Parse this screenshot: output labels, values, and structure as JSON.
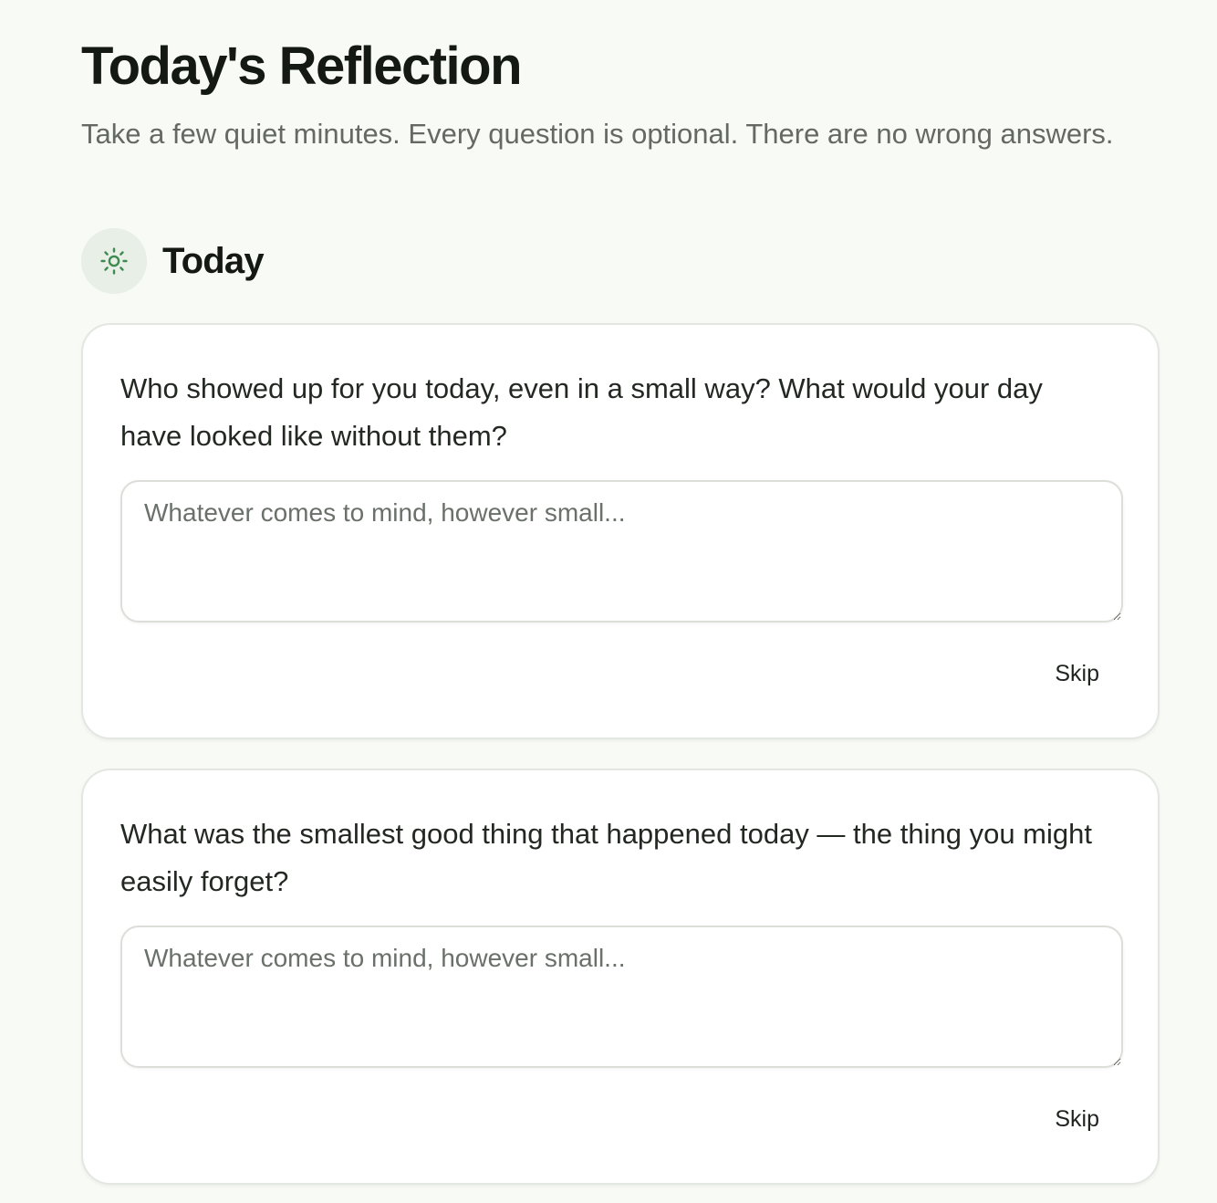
{
  "page": {
    "title": "Today's Reflection",
    "subtitle": "Take a few quiet minutes. Every question is optional. There are no wrong answers."
  },
  "section": {
    "title": "Today",
    "icon": "sun-icon",
    "icon_color": "#3f8a4f",
    "icon_bg": "#e7efe6"
  },
  "questions": [
    {
      "prompt": "Who showed up for you today, even in a small way? What would your day have looked like without them?",
      "placeholder": "Whatever comes to mind, however small...",
      "value": "",
      "skip_label": "Skip"
    },
    {
      "prompt": "What was the smallest good thing that happened today — the thing you might easily forget?",
      "placeholder": "Whatever comes to mind, however small...",
      "value": "",
      "skip_label": "Skip"
    }
  ]
}
